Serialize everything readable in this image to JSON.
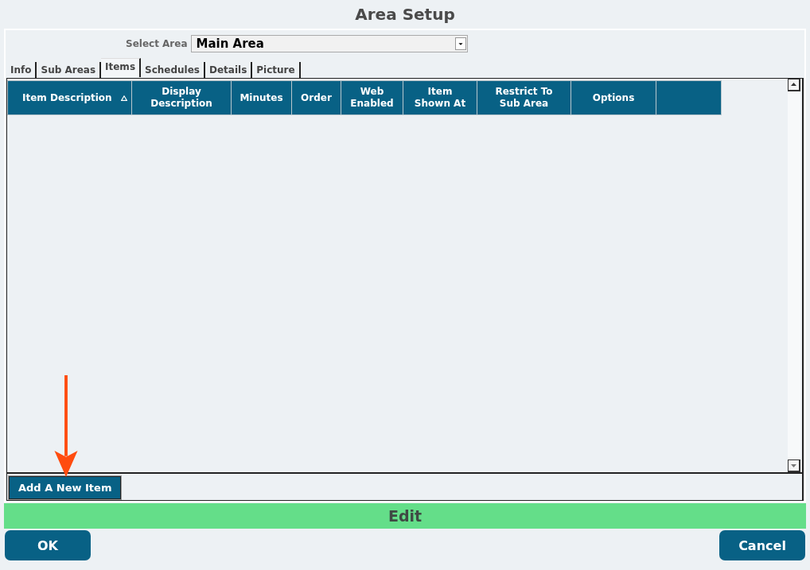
{
  "window": {
    "title": "Area Setup"
  },
  "select_area": {
    "label": "Select Area",
    "value": "Main Area"
  },
  "tabs": [
    {
      "label": "Info",
      "selected": false
    },
    {
      "label": "Sub Areas",
      "selected": false
    },
    {
      "label": "Items",
      "selected": true
    },
    {
      "label": "Schedules",
      "selected": false
    },
    {
      "label": "Details",
      "selected": false
    },
    {
      "label": "Picture",
      "selected": false
    }
  ],
  "table": {
    "columns": [
      {
        "label": "Item Description",
        "sorted": true
      },
      {
        "label": "Display\nDescription",
        "sorted": false
      },
      {
        "label": "Minutes",
        "sorted": false
      },
      {
        "label": "Order",
        "sorted": false
      },
      {
        "label": "Web\nEnabled",
        "sorted": false
      },
      {
        "label": "Item\nShown At",
        "sorted": false
      },
      {
        "label": "Restrict To\nSub Area",
        "sorted": false
      },
      {
        "label": "Options",
        "sorted": false
      },
      {
        "sorted": false
      }
    ]
  },
  "add_button": "Add A New Item",
  "mode_bar": "Edit",
  "buttons": [
    {
      "label": "OK"
    },
    {
      "label": "Cancel"
    }
  ]
}
